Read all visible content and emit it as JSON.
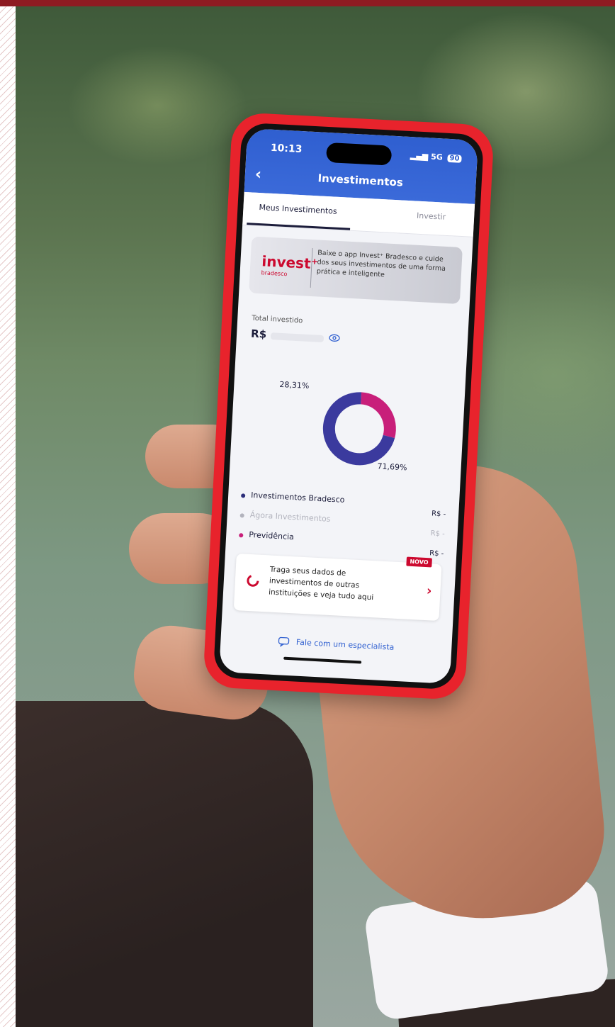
{
  "app": {
    "status_time": "10:13",
    "network": "5G",
    "battery": "90",
    "title": "Investimentos"
  },
  "tabs": [
    {
      "label": "Meus Investimentos",
      "active": true
    },
    {
      "label": "Investir",
      "active": false
    }
  ],
  "promo": {
    "logo": "invest⁺",
    "logo_sub": "bradesco",
    "text": "Baixe o app Invest⁺ Bradesco e cuide dos seus investimentos de uma forma prática e inteligente"
  },
  "total": {
    "label": "Total investido",
    "currency": "R$"
  },
  "chart_data": {
    "type": "pie",
    "labels": [
      "28,31%",
      "71,69%"
    ],
    "values": [
      28.31,
      71.69
    ],
    "colors": [
      "#c81f7a",
      "#3b3a9e"
    ]
  },
  "legend": [
    {
      "label": "Investimentos Bradesco",
      "value": "R$ -",
      "color": "#2b2d7a"
    },
    {
      "label": "Ágora Investimentos",
      "value": "R$ -",
      "color": "#b2b3bd"
    },
    {
      "label": "Previdência",
      "value": "R$ -",
      "color": "#c81f7a"
    }
  ],
  "card": {
    "badge": "NOVO",
    "text": "Traga seus dados de investimentos de outras instituições e veja tudo aqui"
  },
  "footer": {
    "label": "Fale com um especialista"
  },
  "colors": {
    "brand_red": "#cc092f",
    "header_blue": "#2f5fd0",
    "phone_case": "#e8232c"
  }
}
